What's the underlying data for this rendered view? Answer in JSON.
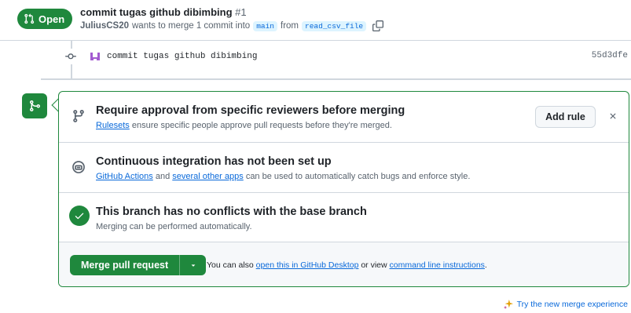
{
  "header": {
    "state_label": "Open",
    "title": "commit tugas github dibimbing",
    "number": "#1",
    "author": "JuliusCS20",
    "meta_text": "wants to merge 1 commit into",
    "base_branch": "main",
    "from_text": "from",
    "head_branch": "read_csv_file"
  },
  "commit": {
    "message": "commit tugas github dibimbing",
    "sha": "55d3dfe"
  },
  "merge_box": {
    "ruleset": {
      "title": "Require approval from specific reviewers before merging",
      "link": "Rulesets",
      "sub": "ensure specific people approve pull requests before they're merged.",
      "add_rule_label": "Add rule"
    },
    "ci": {
      "title": "Continuous integration has not been set up",
      "link1": "GitHub Actions",
      "mid": "and",
      "link2": "several other apps",
      "sub": "can be used to automatically catch bugs and enforce style."
    },
    "conflicts": {
      "title": "This branch has no conflicts with the base branch",
      "sub": "Merging can be performed automatically."
    },
    "merge": {
      "button_label": "Merge pull request",
      "alt_prefix": "You can also",
      "alt_link1": "open this in GitHub Desktop",
      "alt_mid": "or view",
      "alt_link2": "command line instructions",
      "alt_suffix": "."
    }
  },
  "footer": {
    "try_label": "Try the new merge experience"
  },
  "colors": {
    "success": "#1f883d",
    "link": "#0969da",
    "border": "#d0d7de",
    "muted": "#59636e"
  }
}
